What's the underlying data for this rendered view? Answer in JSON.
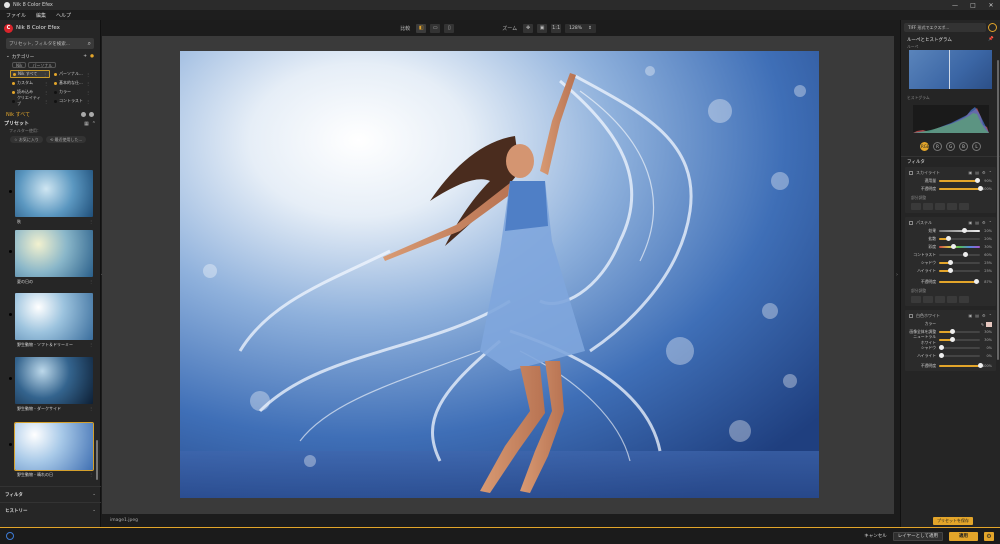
{
  "window": {
    "title": "Nik 8 Color Efex",
    "minimize": "—",
    "maximize": "□",
    "close": "✕"
  },
  "menu": {
    "items": [
      "ファイル",
      "編集",
      "ヘルプ"
    ]
  },
  "left": {
    "app_name": "Nik 8 Color Efex",
    "search_placeholder": "プリセット, フィルタを検索...",
    "categories_label": "カテゴリー",
    "chips": [
      "Nik",
      "パーソナル"
    ],
    "categories": [
      {
        "label": "Nik すべて",
        "color": "#e3a52a",
        "selected": true
      },
      {
        "label": "パーソナル...",
        "color": "#e3a52a",
        "selected": false
      },
      {
        "label": "カスタム",
        "color": "#e3a52a",
        "selected": false
      },
      {
        "label": "基本的な仕...",
        "color": "#e3a52a",
        "selected": false
      },
      {
        "label": "読み込み",
        "color": "#e3a52a",
        "selected": false
      },
      {
        "label": "カラー",
        "color": "#111111",
        "selected": false
      },
      {
        "label": "クリエイティブ",
        "color": "#111111",
        "selected": false
      },
      {
        "label": "コントラスト",
        "color": "#111111",
        "selected": false
      }
    ],
    "nik_all": "Nik すべて",
    "presets_label": "プリセット",
    "filter_note": "フィルター使用：",
    "fav_button": "☆ お気に入り",
    "recent_button": "⟲ 最近使用した...",
    "thumbnails": [
      {
        "label": "秋"
      },
      {
        "label": "夏の日の"
      },
      {
        "label": "野生動物 - ソフト＆ドリーミー"
      },
      {
        "label": "野生動物 - ダークサイド"
      },
      {
        "label": "野生動物 - 晴れの日"
      }
    ],
    "filters_footer": "フィルタ",
    "history_footer": "ヒストリー"
  },
  "toolbar": {
    "compare_label": "比較",
    "zoom_label": "ズーム",
    "zoom_value": "128%",
    "zoom_fit": "1:1"
  },
  "canvas": {
    "filename": "image1.jpeg"
  },
  "right": {
    "format": "TIFF 形式でエクスポ...",
    "loupe_histogram": "ルーペとヒストグラム",
    "loupe_label": "ルーペ",
    "histogram_label": "ヒストグラム",
    "channels": [
      "RGB",
      "R",
      "G",
      "B",
      "L"
    ],
    "filters_title": "フィルタ",
    "filter1": {
      "name": "スカイライト",
      "sliders": [
        {
          "label": "適用量",
          "value": 0.9,
          "display": "90%"
        },
        {
          "label": "不透明度",
          "value": 1.0,
          "display": "100%"
        }
      ],
      "local_adjust": "部分調整"
    },
    "filter2": {
      "name": "パステル",
      "sliders": [
        {
          "label": "効果",
          "value": 0.2,
          "display": "20%",
          "neutral": true
        },
        {
          "label": "拡散",
          "value": 0.2,
          "display": "20%"
        },
        {
          "label": "彩度",
          "value": 0.3,
          "display": "30%",
          "rainbow": true
        },
        {
          "label": "コントラスト",
          "value": 0.6,
          "display": "60%",
          "neutral": true
        },
        {
          "label": "シャドウ",
          "value": 0.25,
          "display": "25%"
        },
        {
          "label": "ハイライト",
          "value": 0.25,
          "display": "25%"
        },
        {
          "label": "不透明度",
          "value": 0.87,
          "display": "87%"
        }
      ],
      "local_adjust": "部分調整"
    },
    "filter3": {
      "name": "白色ホワイト",
      "color_label": "カラー",
      "sliders": [
        {
          "label": "画像全体を調整",
          "value": 0.3,
          "display": "30%"
        },
        {
          "label": "ニュートラル ホワイト",
          "value": 0.3,
          "display": "30%"
        },
        {
          "label": "シャドウ",
          "value": 0.0,
          "display": "0%"
        },
        {
          "label": "ハイライト",
          "value": 0.0,
          "display": "0%"
        },
        {
          "label": "不透明度",
          "value": 1.0,
          "display": "100%"
        }
      ]
    },
    "save_preset": "プリセットを保存"
  },
  "bottom": {
    "cancel": "キャンセル",
    "apply_as_layer": "レイヤーとして適用",
    "apply": "適用"
  },
  "colors": {
    "accent": "#e3a52a",
    "brand": "#d8242b"
  }
}
